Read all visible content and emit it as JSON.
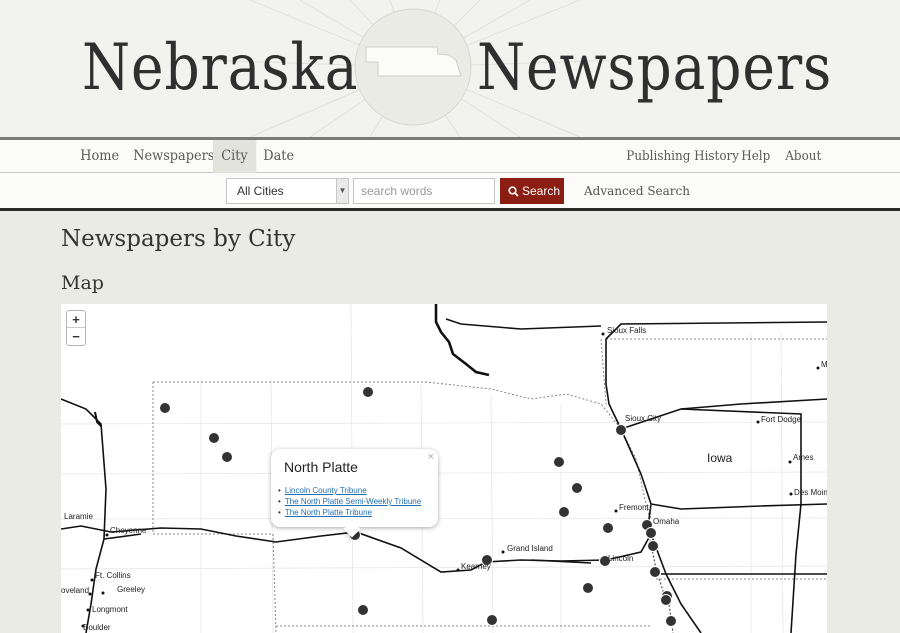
{
  "masthead": {
    "word_left": "Nebraska",
    "word_right": "Newspapers"
  },
  "nav": {
    "left": [
      {
        "label": "Home",
        "active": false
      },
      {
        "label": "Newspapers",
        "active": false
      },
      {
        "label": "City",
        "active": true
      },
      {
        "label": "Date",
        "active": false
      }
    ],
    "right": [
      "Publishing History",
      "Help",
      "About"
    ]
  },
  "search": {
    "city_select_value": "All Cities",
    "input_placeholder": "search words",
    "button_label": "Search",
    "advanced_label": "Advanced Search"
  },
  "page": {
    "title": "Newspapers by City",
    "section": "Map"
  },
  "map": {
    "zoom_in": "+",
    "zoom_out": "−",
    "labels": {
      "sioux_falls": "Sioux Falls",
      "sioux_city": "Sioux City",
      "fort_dodge": "Fort Dodge",
      "ames": "Ames",
      "des_moines": "Des Moin",
      "m": "M",
      "iowa": "Iowa",
      "fremont": "Fremont",
      "omaha": "Omaha",
      "lincoln": "Lincoln",
      "grand_island": "Grand Island",
      "kearney": "Kearney",
      "laramie": "Laramie",
      "cheyenne": "Cheyenne",
      "ft_collins": "Ft. Collins",
      "greeley": "Greeley",
      "loveland": "oveland",
      "longmont": "Longmont",
      "boulder": "Boulder"
    },
    "popup": {
      "title": "North Platte",
      "close": "×",
      "items": [
        "Lincoln County Tribune",
        "The North Platte Semi-Weekly Tribune",
        "The North Platte Tribune"
      ]
    },
    "colors": {
      "marker": "#333333",
      "road": "#111111",
      "border": "#888888"
    }
  }
}
